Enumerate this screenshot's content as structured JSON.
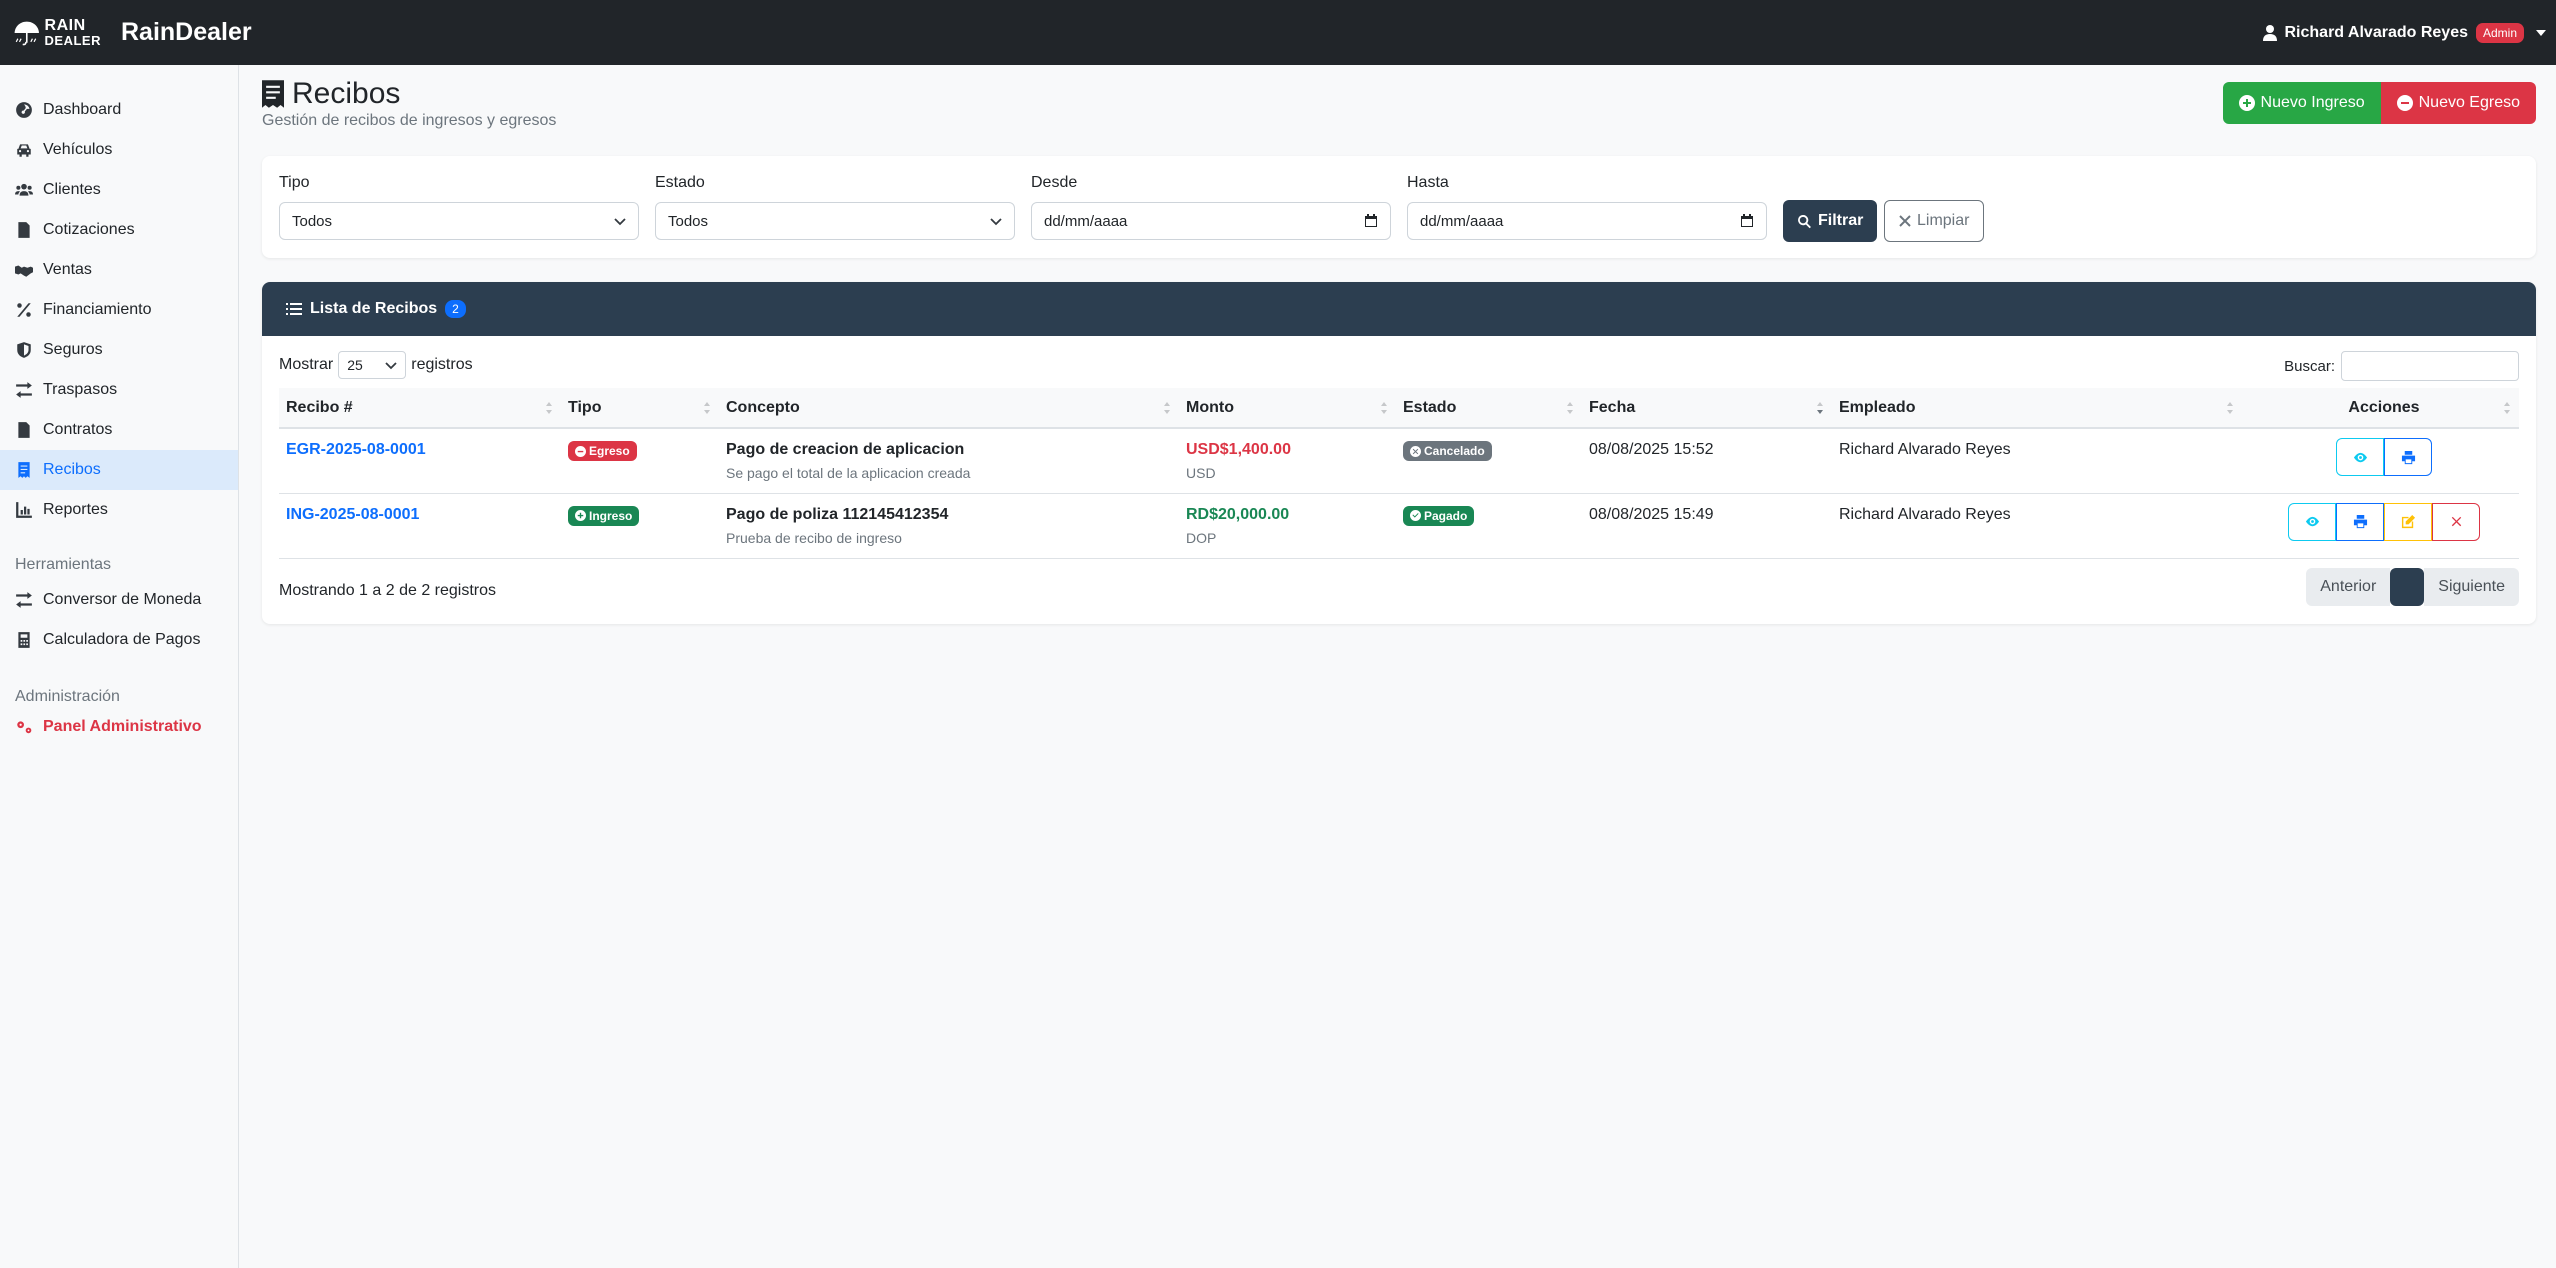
{
  "brand": {
    "logo_line1": "RAIN",
    "logo_line2": "DEALER",
    "name": "RainDealer"
  },
  "user": {
    "name": "Richard Alvarado Reyes",
    "role_badge": "Admin"
  },
  "sidebar": {
    "items": [
      {
        "label": "Dashboard",
        "icon": "dashboard-icon"
      },
      {
        "label": "Vehículos",
        "icon": "car-icon"
      },
      {
        "label": "Clientes",
        "icon": "users-icon"
      },
      {
        "label": "Cotizaciones",
        "icon": "file-icon"
      },
      {
        "label": "Ventas",
        "icon": "handshake-icon"
      },
      {
        "label": "Financiamiento",
        "icon": "percent-icon"
      },
      {
        "label": "Seguros",
        "icon": "shield-icon"
      },
      {
        "label": "Traspasos",
        "icon": "exchange-icon"
      },
      {
        "label": "Contratos",
        "icon": "contract-icon"
      },
      {
        "label": "Recibos",
        "icon": "receipt-icon"
      },
      {
        "label": "Reportes",
        "icon": "chart-icon"
      }
    ],
    "tools_heading": "Herramientas",
    "tools": [
      {
        "label": "Conversor de Moneda",
        "icon": "exchange-icon"
      },
      {
        "label": "Calculadora de Pagos",
        "icon": "calculator-icon"
      }
    ],
    "admin_heading": "Administración",
    "admin_item": {
      "label": "Panel Administrativo",
      "icon": "gears-icon"
    }
  },
  "page": {
    "title": "Recibos",
    "subtitle": "Gestión de recibos de ingresos y egresos",
    "btn_new_income": "Nuevo Ingreso",
    "btn_new_expense": "Nuevo Egreso"
  },
  "filters": {
    "tipo_label": "Tipo",
    "tipo_value": "Todos",
    "estado_label": "Estado",
    "estado_value": "Todos",
    "desde_label": "Desde",
    "desde_value": "dd/mm/aaaa",
    "hasta_label": "Hasta",
    "hasta_value": "dd/mm/aaaa",
    "btn_filter": "Filtrar",
    "btn_clear": "Limpiar"
  },
  "list": {
    "title": "Lista de Recibos",
    "count": "2",
    "show_label": "Mostrar",
    "show_value": "25",
    "records_label": "registros",
    "search_label": "Buscar:",
    "columns": [
      "Recibo #",
      "Tipo",
      "Concepto",
      "Monto",
      "Estado",
      "Fecha",
      "Empleado",
      "Acciones"
    ],
    "rows": [
      {
        "recibo": "EGR-2025-08-0001",
        "tipo": "Egreso",
        "concepto": "Pago de creacion de aplicacion",
        "concepto_sub": "Se pago el total de la aplicacion creada",
        "monto": "USD$1,400.00",
        "moneda": "USD",
        "estado": "Cancelado",
        "fecha": "08/08/2025 15:52",
        "empleado": "Richard Alvarado Reyes"
      },
      {
        "recibo": "ING-2025-08-0001",
        "tipo": "Ingreso",
        "concepto": "Pago de poliza 112145412354",
        "concepto_sub": "Prueba de recibo de ingreso",
        "monto": "RD$20,000.00",
        "moneda": "DOP",
        "estado": "Pagado",
        "fecha": "08/08/2025 15:49",
        "empleado": "Richard Alvarado Reyes"
      }
    ],
    "info": "Mostrando 1 a 2 de 2 registros",
    "prev": "Anterior",
    "next": "Siguiente"
  },
  "colors": {
    "navbar": "#212529",
    "accent_dark": "#2c3e50",
    "primary": "#0d6efd",
    "success": "#28a745",
    "danger": "#dc3545"
  }
}
